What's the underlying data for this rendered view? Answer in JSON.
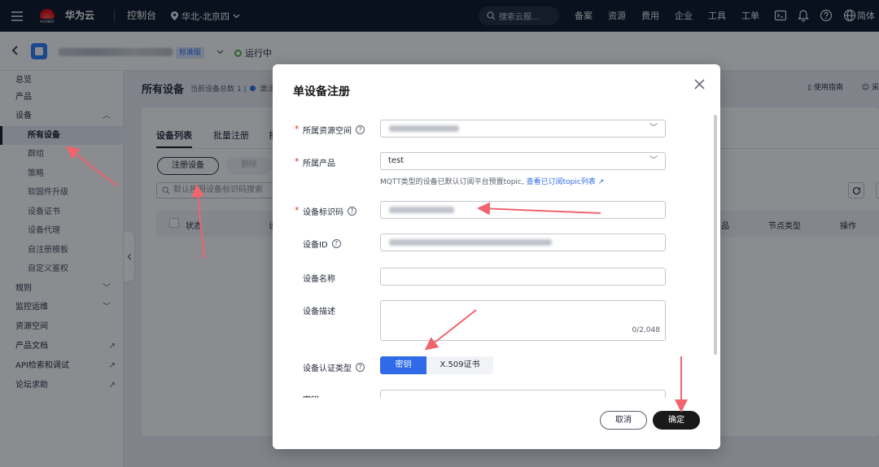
{
  "topbar": {
    "brand": "华为云",
    "logo_text": "HUAWEI",
    "console": "控制台",
    "region": "华北-北京四",
    "search_placeholder": "搜索云服...",
    "nav": [
      "备案",
      "资源",
      "费用",
      "企业",
      "工具",
      "工单"
    ],
    "language": "简体"
  },
  "subheader": {
    "edition": "标准版",
    "status": "运行中"
  },
  "sidebar": {
    "items": [
      {
        "label": "总览"
      },
      {
        "label": "产品"
      },
      {
        "label": "设备"
      },
      {
        "label": "所有设备"
      },
      {
        "label": "群组"
      },
      {
        "label": "策略"
      },
      {
        "label": "软固件升级"
      },
      {
        "label": "设备证书"
      },
      {
        "label": "设备代理"
      },
      {
        "label": "自注册模板"
      },
      {
        "label": "自定义鉴权"
      },
      {
        "label": "规则"
      },
      {
        "label": "监控运维"
      },
      {
        "label": "资源空间"
      },
      {
        "label": "产品文档"
      },
      {
        "label": "API检索和调试"
      },
      {
        "label": "论坛求助"
      }
    ]
  },
  "main": {
    "title": "所有设备",
    "count_text": "当前设备总数 1 |",
    "active_text": "激活",
    "guide": "使用指南",
    "guide2": "采",
    "tabs": [
      "设备列表",
      "批量注册",
      "批"
    ],
    "register_button": "注册设备",
    "delete_button": "删除",
    "search_placeholder": "默认按照设备标识码搜索",
    "columns": [
      "状态",
      "设",
      "品",
      "节点类型",
      "操作"
    ]
  },
  "modal": {
    "title": "单设备注册",
    "fields": {
      "space": {
        "label": "所属资源空间"
      },
      "product": {
        "label": "所属产品",
        "value": "test"
      },
      "node_id": {
        "label": "设备标识码"
      },
      "device_id": {
        "label": "设备ID"
      },
      "name": {
        "label": "设备名称"
      },
      "desc": {
        "label": "设备描述",
        "counter": "0/2,048"
      },
      "auth": {
        "label": "设备认证类型",
        "options": [
          "密钥",
          "X.509证书"
        ],
        "selected": "密钥"
      },
      "secret": {
        "label": "密钥"
      }
    },
    "hint": "MQTT类型的设备已默认订阅平台预置topic,",
    "hint_link": "查看已订阅topic列表",
    "cancel": "取消",
    "confirm": "确定"
  },
  "colors": {
    "accent": "#2f6ae8",
    "primary_button": "#191919",
    "annotation": "#f0646e"
  }
}
